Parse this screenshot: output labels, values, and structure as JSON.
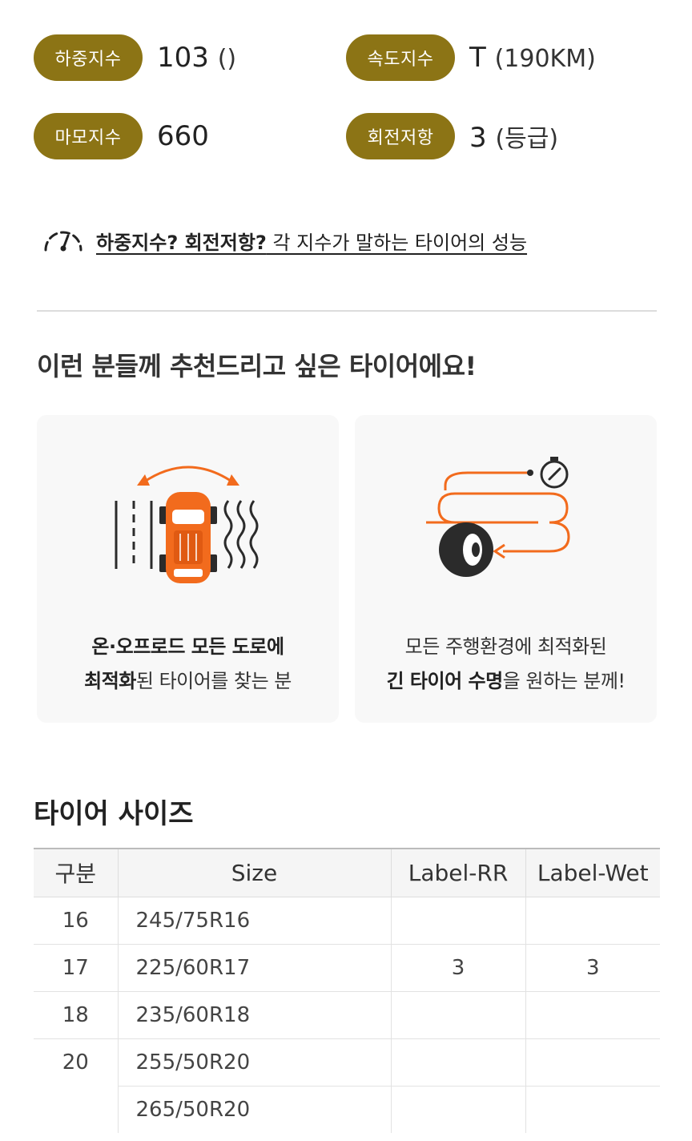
{
  "specs": {
    "load": {
      "label": "하중지수",
      "value": "103",
      "unit": "()"
    },
    "speed": {
      "label": "속도지수",
      "value": "T",
      "unit": "(190KM)"
    },
    "wear": {
      "label": "마모지수",
      "value": "660",
      "unit": ""
    },
    "rolling": {
      "label": "회전저항",
      "value": "3",
      "unit": "(등급)"
    }
  },
  "info_link": {
    "bold": "하중지수? 회전저항?",
    "rest": " 각 지수가 말하는 타이어의 성능",
    "icon": "gauge-icon"
  },
  "recommend": {
    "title": "이런 분들께 추천드리고 싶은 타이어에요!",
    "cards": [
      {
        "icon": "car-road-icon",
        "line1_bold": "온·오프로드 모든 도로에",
        "line2_bold": "최적화",
        "line2_rest": "된 타이어를 찾는 분"
      },
      {
        "icon": "tire-route-icon",
        "line1": "모든 주행환경에 최적화된",
        "line2_bold": "긴 타이어 수명",
        "line2_rest": "을 원하는 분께!"
      }
    ]
  },
  "sizes": {
    "title": "타이어 사이즈",
    "headers": [
      "구분",
      "Size",
      "Label-RR",
      "Label-Wet"
    ],
    "rows": [
      {
        "group": "16",
        "size": "245/75R16",
        "rr": "",
        "wet": ""
      },
      {
        "group": "17",
        "size": "225/60R17",
        "rr": "3",
        "wet": "3"
      },
      {
        "group": "18",
        "size": "235/60R18",
        "rr": "",
        "wet": ""
      },
      {
        "group": "20",
        "size": "255/50R20",
        "rr": "",
        "wet": ""
      },
      {
        "group": "",
        "size": "265/50R20",
        "rr": "",
        "wet": ""
      }
    ]
  },
  "colors": {
    "pill": "#8c7415",
    "accent": "#f26b1d",
    "dark": "#2b2b2b"
  }
}
